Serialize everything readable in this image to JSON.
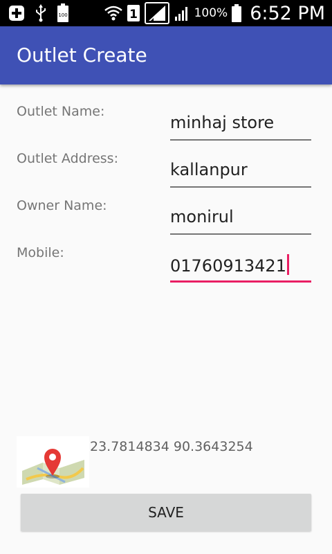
{
  "status_bar": {
    "left_icons": [
      "add-icon",
      "usb-icon",
      "battery-100-icon"
    ],
    "right_icons": [
      "wifi-icon",
      "sim-1-icon",
      "signal-icon",
      "signal-icon",
      "battery-icon"
    ],
    "battery_text": "100%",
    "time": "6:52 PM"
  },
  "app_bar": {
    "title": "Outlet Create",
    "color": "#3f51b5"
  },
  "form": {
    "outlet_name": {
      "label": "Outlet Name:",
      "value": "minhaj store"
    },
    "outlet_address": {
      "label": "Outlet Address:",
      "value": "kallanpur"
    },
    "owner_name": {
      "label": "Owner Name:",
      "value": "monirul"
    },
    "mobile": {
      "label": "Mobile:",
      "value": "01760913421"
    },
    "accent_color": "#e91e63"
  },
  "location": {
    "icon": "map-pin-icon",
    "coordinates": "23.7814834 90.3643254"
  },
  "save_button": {
    "label": "SAVE"
  }
}
